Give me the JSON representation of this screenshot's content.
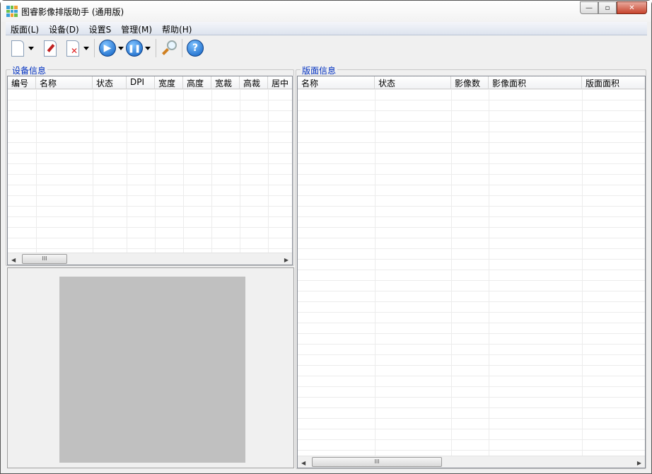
{
  "window": {
    "title": "图睿影像排版助手 (通用版)",
    "minimize": "—",
    "maximize": "▫",
    "close": "✕"
  },
  "menu": [
    "版面(L)",
    "设备(D)",
    "设置S",
    "管理(M)",
    "帮助(H)"
  ],
  "toolbar": {
    "help_glyph": "?"
  },
  "device_panel": {
    "label": "设备信息",
    "columns": [
      "编号",
      "名称",
      "状态",
      "DPI",
      "宽度",
      "高度",
      "宽裁",
      "高裁",
      "居中"
    ],
    "rows": []
  },
  "layout_panel": {
    "label": "版面信息",
    "columns": [
      "名称",
      "状态",
      "影像数",
      "影像面积",
      "版面面积"
    ],
    "rows": []
  },
  "scroll": {
    "thumb_grip": "III"
  },
  "colors": {
    "group_label": "#0030c0",
    "preview": "#c0c0c0"
  }
}
